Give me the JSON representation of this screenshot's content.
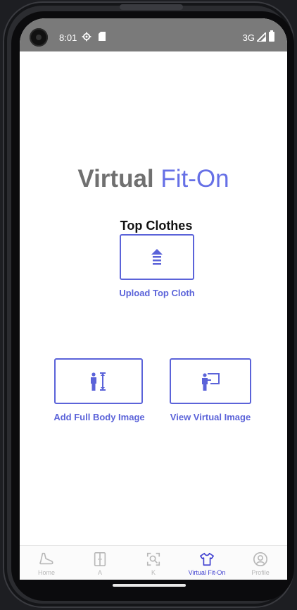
{
  "status_bar": {
    "time": "8:01",
    "network": "3G",
    "icons": [
      "camera-icon",
      "gear-icon",
      "sd-card-icon",
      "signal-icon",
      "battery-icon"
    ]
  },
  "page": {
    "title_bold": "Virtual",
    "title_light": "Fit-On",
    "section_label": "Top Clothes",
    "upload_caption": "Upload Top Cloth",
    "full_body_caption": "Add Full Body Image",
    "view_caption": "View Virtual Image"
  },
  "bottom_nav": {
    "items": [
      {
        "label": "Home",
        "icon": "shoe-icon"
      },
      {
        "label": "A",
        "icon": "wardrobe-icon"
      },
      {
        "label": "K",
        "icon": "scan-search-icon"
      },
      {
        "label": "Virtual Fit-On",
        "icon": "tshirt-icon"
      },
      {
        "label": "Profile",
        "icon": "profile-icon"
      }
    ]
  },
  "colors": {
    "accent": "#5b63d9",
    "active_nav": "#3f3fd0",
    "status_bar": "#7a7a7a",
    "inactive_nav": "#b8b8b8"
  }
}
